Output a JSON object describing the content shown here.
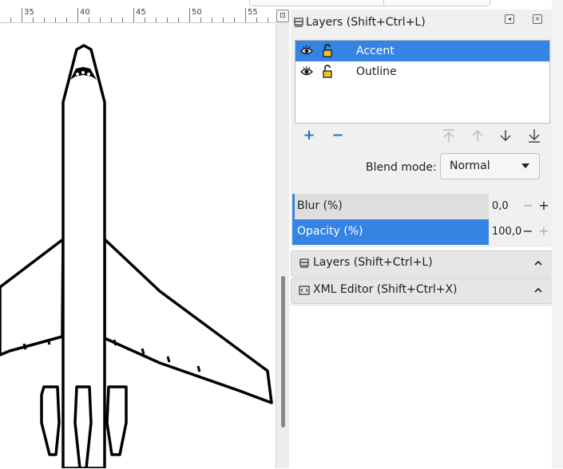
{
  "ruler": {
    "labels": [
      "35",
      "40",
      "45",
      "50",
      "55"
    ],
    "corner_icon": "lock-guides-icon"
  },
  "drawing": {
    "description_icon": "airplane-outline-icon",
    "stroke_color": "#000000"
  },
  "layers_panel": {
    "title": "Layers (Shift+Ctrl+L)",
    "header_icons": [
      "pin-icon",
      "close-icon"
    ],
    "layers": [
      {
        "name": "Accent",
        "selected": true,
        "visible": true,
        "locked": false
      },
      {
        "name": "Outline",
        "selected": false,
        "visible": true,
        "locked": false
      }
    ],
    "tools": [
      "add-layer-icon",
      "remove-layer-icon",
      "raise-to-top-icon",
      "raise-icon",
      "lower-icon",
      "lower-to-bottom-icon"
    ],
    "blend_label": "Blend mode:",
    "blend_value": "Normal",
    "blur": {
      "label": "Blur (%)",
      "value": "0,0",
      "fraction": 0.0
    },
    "opacity": {
      "label": "Opacity (%)",
      "value": "100,0",
      "fraction": 1.0
    }
  },
  "collapsed_dialogs": [
    {
      "label": "Layers (Shift+Ctrl+L)",
      "icon": "layers-icon"
    },
    {
      "label": "XML Editor (Shift+Ctrl+X)",
      "icon": "xml-editor-icon"
    }
  ],
  "colors": {
    "accent": "#3584e4",
    "panel_bg": "#f0f0f0"
  }
}
